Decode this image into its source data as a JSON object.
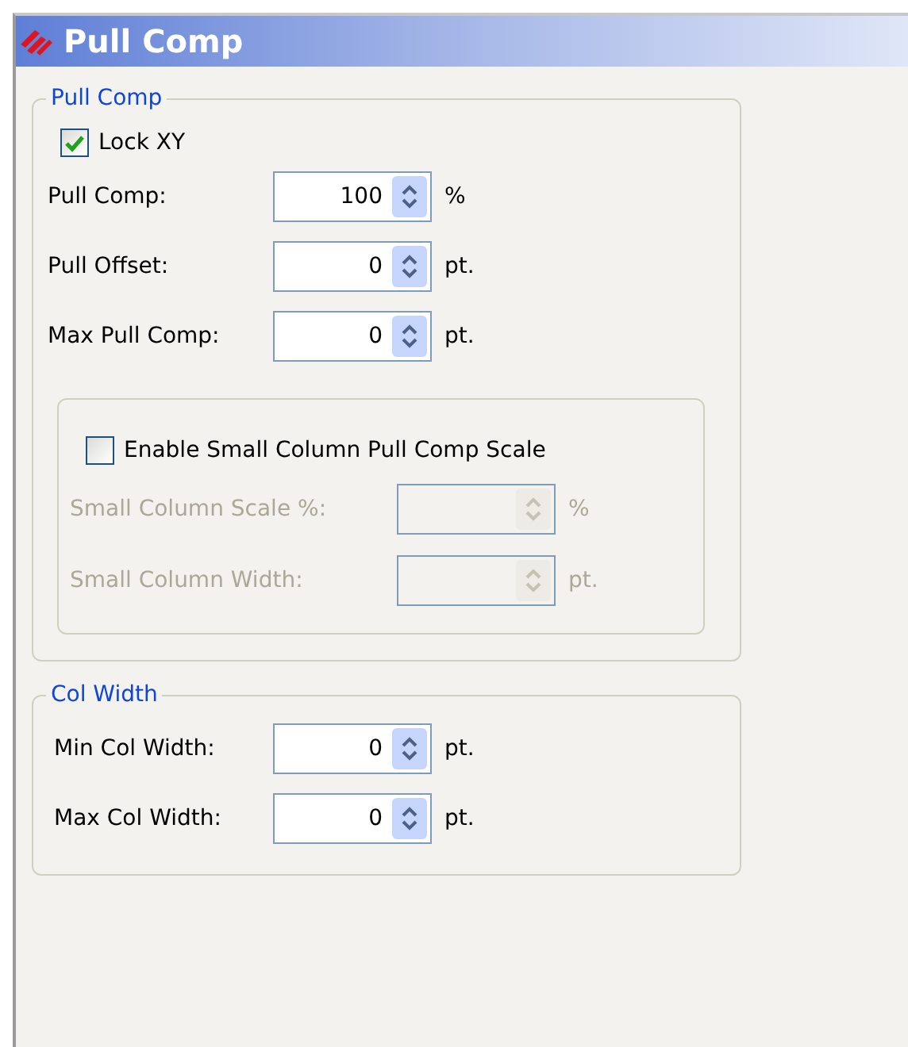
{
  "title": "Pull Comp",
  "pull_comp": {
    "legend": "Pull Comp",
    "lock_xy": {
      "label": "Lock XY",
      "checked": true
    },
    "fields": [
      {
        "label": "Pull Comp:",
        "value": "100",
        "unit": "%",
        "disabled": false
      },
      {
        "label": "Pull Offset:",
        "value": "0",
        "unit": "pt.",
        "disabled": false
      },
      {
        "label": "Max Pull Comp:",
        "value": "0",
        "unit": "pt.",
        "disabled": false
      }
    ],
    "small_column": {
      "enable": {
        "label": "Enable Small Column Pull Comp Scale",
        "checked": false
      },
      "fields": [
        {
          "label": "Small Column Scale %:",
          "unit": "%",
          "disabled": true
        },
        {
          "label": "Small Column Width:",
          "unit": "pt.",
          "disabled": true
        }
      ]
    }
  },
  "col_width": {
    "legend": "Col Width",
    "fields": [
      {
        "label": "Min Col Width:",
        "value": "0",
        "unit": "pt.",
        "disabled": false
      },
      {
        "label": "Max Col Width:",
        "value": "0",
        "unit": "pt.",
        "disabled": false
      }
    ]
  }
}
